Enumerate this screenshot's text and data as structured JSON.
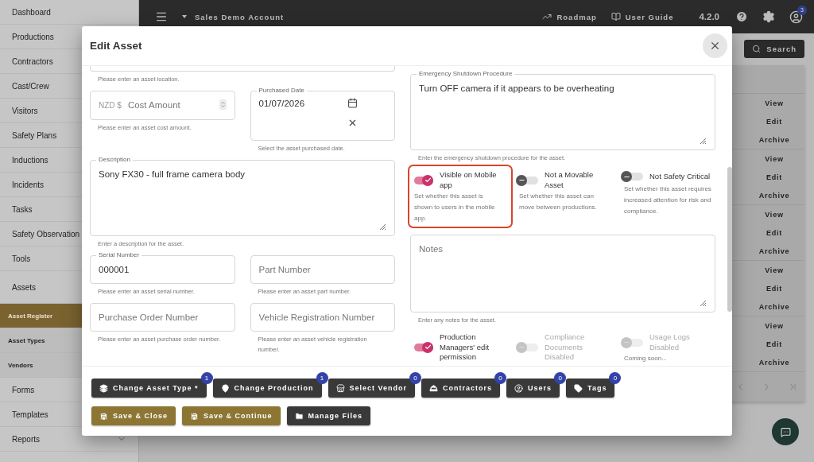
{
  "sidebar": {
    "items": [
      {
        "label": "Dashboard",
        "kind": "main",
        "selected": false
      },
      {
        "label": "Productions",
        "kind": "main",
        "selected": false
      },
      {
        "label": "Contractors",
        "kind": "main",
        "selected": false
      },
      {
        "label": "Cast/Crew",
        "kind": "main",
        "selected": false
      },
      {
        "label": "Visitors",
        "kind": "main",
        "selected": false
      },
      {
        "label": "Safety Plans",
        "kind": "main",
        "selected": false
      },
      {
        "label": "Inductions",
        "kind": "main",
        "selected": false
      },
      {
        "label": "Incidents",
        "kind": "main",
        "selected": false
      },
      {
        "label": "Tasks",
        "kind": "main",
        "selected": false
      },
      {
        "label": "Safety Observation",
        "kind": "main",
        "selected": false
      },
      {
        "label": "Tools",
        "kind": "main",
        "selected": false
      },
      {
        "label": "Assets",
        "kind": "parent",
        "selected": false
      },
      {
        "label": "Asset Register",
        "kind": "sub",
        "selected": true
      },
      {
        "label": "Asset Types",
        "kind": "sub",
        "selected": false
      },
      {
        "label": "Vendors",
        "kind": "sub",
        "selected": false
      },
      {
        "label": "Forms",
        "kind": "main",
        "selected": false
      },
      {
        "label": "Templates",
        "kind": "main",
        "selected": false
      },
      {
        "label": "Reports",
        "kind": "expandable",
        "selected": false
      }
    ]
  },
  "topbar": {
    "account": "Sales Demo Account",
    "links": [
      {
        "label": "Roadmap",
        "kind": "roadmap"
      },
      {
        "label": "User Guide",
        "kind": "guide"
      }
    ],
    "version": "4.2.0",
    "notification_count": "3"
  },
  "search_button": "Search",
  "table": {
    "rows": [
      {
        "actions": [
          "View",
          "Edit",
          "Archive"
        ]
      },
      {
        "actions": [
          "View",
          "Edit",
          "Archive"
        ]
      },
      {
        "actions": [
          "View",
          "Edit",
          "Archive"
        ]
      },
      {
        "actions": [
          "View",
          "Edit",
          "Archive"
        ]
      },
      {
        "actions": [
          "View",
          "Edit",
          "Archive"
        ]
      }
    ]
  },
  "dialog": {
    "title": "Edit Asset",
    "left": [
      {
        "kind": "cut",
        "helper": "Please enter an asset location."
      },
      {
        "kind": "row",
        "fields": [
          {
            "kind": "currency",
            "prefix": "NZD $",
            "placeholder": "Cost Amount",
            "helper": "Please enter an asset cost amount."
          },
          {
            "kind": "date",
            "label": "Purchased Date",
            "value": "01/07/2026",
            "helper": "Select the asset purchased date."
          }
        ]
      },
      {
        "kind": "textarea",
        "label": "Description",
        "value": "Sony FX30 - full frame camera body",
        "helper": "Enter a description for the asset."
      },
      {
        "kind": "row",
        "fields": [
          {
            "kind": "text",
            "label": "Serial Number",
            "value": "000001",
            "helper": "Please enter an asset serial number."
          },
          {
            "kind": "text",
            "placeholder": "Part Number",
            "helper": "Please enter an asset part number."
          }
        ]
      },
      {
        "kind": "row",
        "fields": [
          {
            "kind": "text",
            "placeholder": "Purchase Order Number",
            "helper": "Please enter an asset purchase order number."
          },
          {
            "kind": "text",
            "placeholder": "Vehicle Registration Number",
            "helper": "Please enter an asset vehicle registration number."
          }
        ]
      }
    ],
    "right": [
      {
        "kind": "textarea",
        "label": "Emergency Shutdown Procedure",
        "value": "Turn OFF camera if it appears to be overheating",
        "helper": "Enter the emergency shutdown procedure for the asset."
      },
      {
        "kind": "switches",
        "items": [
          {
            "label": "Visible on Mobile app",
            "helper": "Set whether this asset is shown to users in the mobile app.",
            "on": true,
            "disabled": false,
            "highlighted": true
          },
          {
            "label": "Not a Movable Asset",
            "helper": "Set whether this asset can move between productions.",
            "on": false,
            "disabled": false,
            "highlighted": false
          },
          {
            "label": "Not Safety Critical",
            "helper": "Set whether this asset requires increased attention for risk and compliance.",
            "on": false,
            "disabled": false,
            "highlighted": false
          }
        ]
      },
      {
        "kind": "textarea",
        "placeholder": "Notes",
        "helper": "Enter any notes for the asset."
      },
      {
        "kind": "switches",
        "items": [
          {
            "label": "Production Managers' edit permission",
            "on": true,
            "disabled": false,
            "highlighted": false
          },
          {
            "label": "Compliance Documents Disabled",
            "on": false,
            "disabled": true,
            "highlighted": false
          },
          {
            "label": "Usage Logs Disabled",
            "helper": "Coming soon...",
            "on": false,
            "disabled": true,
            "highlighted": false
          }
        ]
      }
    ],
    "link_buttons": [
      {
        "label": "Change Asset Type *",
        "kind": "type",
        "count": "1"
      },
      {
        "label": "Change Production",
        "kind": "production",
        "count": "1"
      },
      {
        "label": "Select Vendor",
        "kind": "vendor",
        "count": "0"
      },
      {
        "label": "Contractors",
        "kind": "contractors",
        "count": "0"
      },
      {
        "label": "Users",
        "kind": "users",
        "count": "0"
      },
      {
        "label": "Tags",
        "kind": "tags",
        "count": "0"
      }
    ],
    "actions": [
      {
        "label": "Save & Close",
        "kind": "primary"
      },
      {
        "label": "Save & Continue",
        "kind": "primary"
      },
      {
        "label": "Manage Files",
        "kind": "secondary"
      }
    ]
  }
}
